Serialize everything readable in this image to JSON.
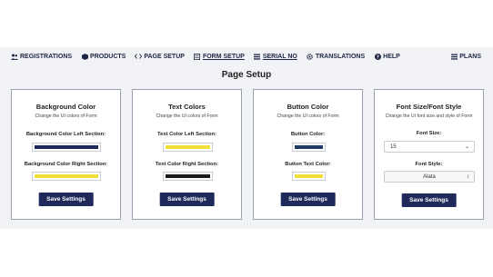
{
  "nav": {
    "items": [
      {
        "label": "REGISTRATIONS",
        "icon": "users-icon"
      },
      {
        "label": "PRODUCTS",
        "icon": "cube-icon"
      },
      {
        "label": "PAGE SETUP",
        "icon": "code-icon"
      },
      {
        "label": "FORM SETUP",
        "icon": "form-icon"
      },
      {
        "label": "SERIAL NO",
        "icon": "list-icon"
      },
      {
        "label": "TRANSLATIONS",
        "icon": "gear-icon"
      },
      {
        "label": "HELP",
        "icon": "help-icon"
      }
    ],
    "plans_label": "PLANS"
  },
  "page_title": "Page Setup",
  "cards": {
    "background": {
      "title": "Background Color",
      "subtitle": "Change the UI colors of Form",
      "left_label": "Background Color Left Section:",
      "left_color": "#1f2a5a",
      "right_label": "Background Color Right Section:",
      "right_color": "#f0e13a",
      "button": "Save Settings"
    },
    "text": {
      "title": "Text Colors",
      "subtitle": "Change the UI colors of Form",
      "left_label": "Text Color Left Section:",
      "left_color": "#f0e13a",
      "right_label": "Text Color Right Section:",
      "right_color": "#1a1a1a",
      "button": "Save Settings"
    },
    "button": {
      "title": "Button Color",
      "subtitle": "Change the UI colors of Form",
      "color_label": "Button Color:",
      "color": "#1f3a63",
      "text_label": "Button Text Color:",
      "text_color": "#f0e13a",
      "button": "Save Settings"
    },
    "font": {
      "title": "Font Size/Font Style",
      "subtitle": "Change the UI font size and style of Form",
      "size_label": "Font Size:",
      "size_value": "15",
      "style_label": "Font Style:",
      "style_value": "Alata",
      "button": "Save Settings"
    }
  },
  "colors": {
    "accent": "#1f2a5a",
    "nav_text": "#1c2544",
    "panel_bg": "#f1f3f6"
  }
}
